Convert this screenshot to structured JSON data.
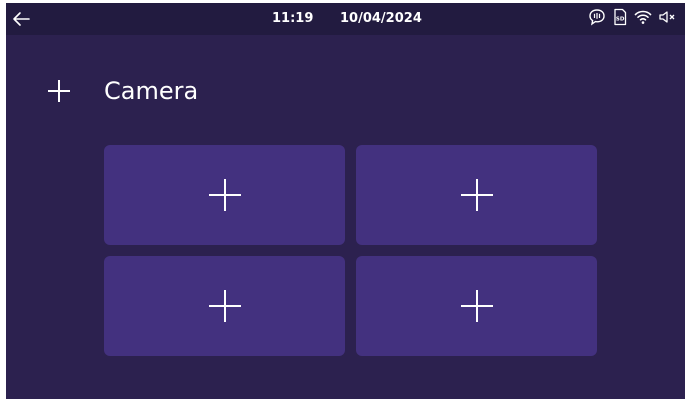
{
  "status_bar": {
    "time": "11:19",
    "date": "10/04/2024",
    "icons": [
      "back-arrow-icon",
      "intercom-icon",
      "sd-card-icon",
      "wifi-icon",
      "speaker-muted-icon"
    ]
  },
  "header": {
    "title": "Camera",
    "add_icon": "plus-icon"
  },
  "tiles": [
    {
      "icon": "plus-icon"
    },
    {
      "icon": "plus-icon"
    },
    {
      "icon": "plus-icon"
    },
    {
      "icon": "plus-icon"
    }
  ],
  "colors": {
    "background": "#2c214f",
    "statusbar": "#221b40",
    "tile": "#43317f",
    "text": "#ffffff"
  }
}
